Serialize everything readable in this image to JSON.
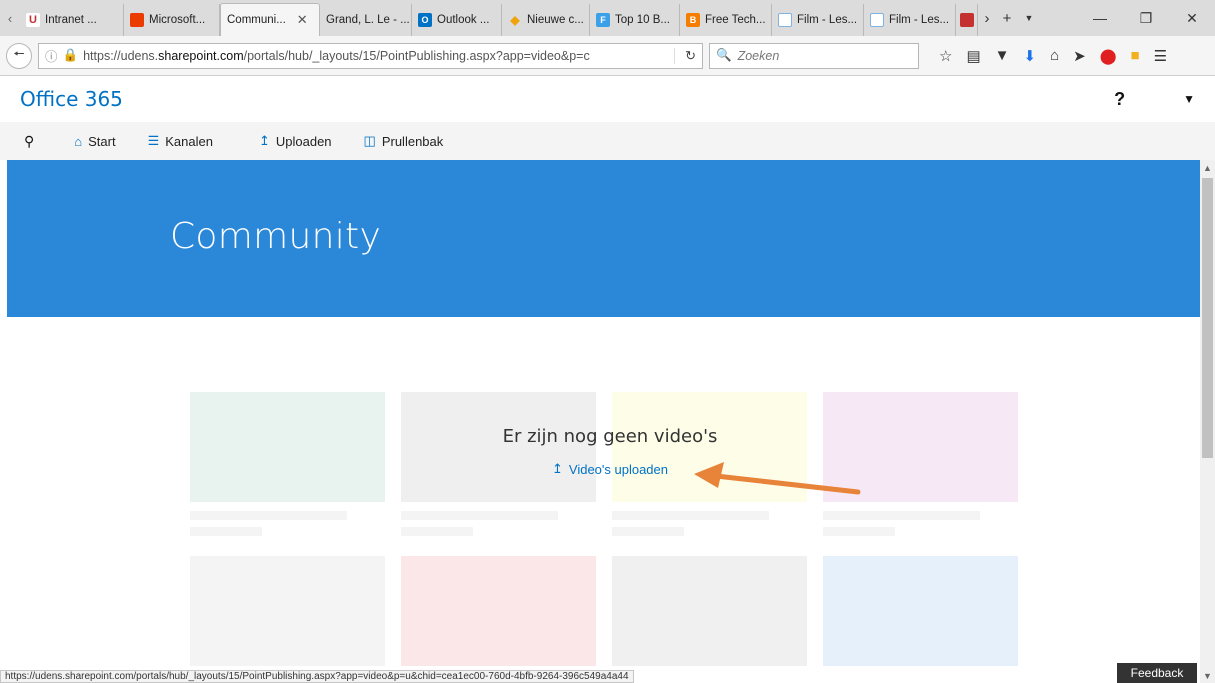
{
  "browser": {
    "tabs": [
      {
        "label": "Intranet ...",
        "icon": "U",
        "color": "#c53030",
        "active": false
      },
      {
        "label": "Microsoft...",
        "icon": "O",
        "color": "#eb3c00",
        "active": false
      },
      {
        "label": "Communi...",
        "icon": "",
        "color": "",
        "active": true
      },
      {
        "label": "Grand, L. Le - ...",
        "icon": "",
        "color": "",
        "active": false
      },
      {
        "label": "Outlook ...",
        "icon": "O",
        "color": "#0072c6",
        "active": false
      },
      {
        "label": "Nieuwe c...",
        "icon": "◆",
        "color": "#f0a30a",
        "active": false
      },
      {
        "label": "Top 10 B...",
        "icon": "F",
        "color": "#3aa0e8",
        "active": false
      },
      {
        "label": "Free Tech...",
        "icon": "B",
        "color": "#f57d00",
        "active": false
      },
      {
        "label": "Film - Les...",
        "icon": "▢",
        "color": "#7fb3e0",
        "active": false
      },
      {
        "label": "Film - Les...",
        "icon": "▢",
        "color": "#7fb3e0",
        "active": false
      }
    ],
    "url_prefix": "https://udens.",
    "url_host": "sharepoint.com",
    "url_rest": "/portals/hub/_layouts/15/PointPublishing.aspx?app=video&p=c",
    "search_placeholder": "Zoeken",
    "status_url": "https://udens.sharepoint.com/portals/hub/_layouts/15/PointPublishing.aspx?app=video&p=u&chid=cea1ec00-760d-4bfb-9264-396c549a4a44"
  },
  "o365": {
    "title": "Office 365",
    "help": "?"
  },
  "commands": {
    "start": "Start",
    "channels": "Kanalen",
    "upload": "Uploaden",
    "recycle": "Prullenbak"
  },
  "hero": {
    "title": "Community"
  },
  "empty_state": {
    "title": "Er zijn nog geen video's",
    "link": "Video's uploaden"
  },
  "tiles": {
    "colors_row1": [
      "#e8f3f0",
      "#efefef",
      "#fdfde8",
      "#f7e8f6"
    ],
    "colors_row2": [
      "#f4f4f4",
      "#fbe6e8",
      "#f0f0f0",
      "#e6f0fa"
    ]
  },
  "accent_color": "#2b88d8",
  "annotation_arrow_color": "#e8833a",
  "feedback": "Feedback"
}
